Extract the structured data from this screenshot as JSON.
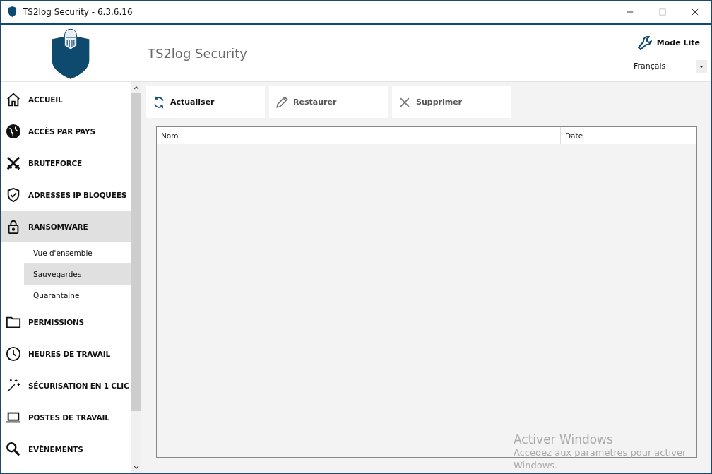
{
  "window": {
    "title": "TS2log Security - 6.3.6.16"
  },
  "header": {
    "title": "TS2log Security",
    "mode_button": "Mode Lite",
    "language": "Français"
  },
  "sidebar": {
    "items": [
      {
        "label": "ACCUEIL",
        "selected": false
      },
      {
        "label": "ACCÈS PAR PAYS",
        "selected": false
      },
      {
        "label": "BRUTEFORCE",
        "selected": false
      },
      {
        "label": "ADRESSES IP BLOQUÉES",
        "selected": false
      },
      {
        "label": "RANSOMWARE",
        "selected": true,
        "children": [
          {
            "label": "Vue d'ensemble",
            "selected": false
          },
          {
            "label": "Sauvegardes",
            "selected": true
          },
          {
            "label": "Quarantaine",
            "selected": false
          }
        ]
      },
      {
        "label": "PERMISSIONS",
        "selected": false
      },
      {
        "label": "HEURES DE TRAVAIL",
        "selected": false
      },
      {
        "label": "SÉCURISATION EN 1 CLIC",
        "selected": false
      },
      {
        "label": "POSTES DE TRAVAIL",
        "selected": false
      },
      {
        "label": "EVÈNEMENTS",
        "selected": false
      }
    ]
  },
  "toolbar": [
    {
      "label": "Actualiser",
      "disabled": false
    },
    {
      "label": "Restaurer",
      "disabled": true
    },
    {
      "label": "Supprimer",
      "disabled": true
    }
  ],
  "table": {
    "columns": [
      "Nom",
      "Date"
    ]
  },
  "activation": {
    "title": "Activer Windows",
    "text": "Accédez aux paramètres pour activer Windows."
  }
}
